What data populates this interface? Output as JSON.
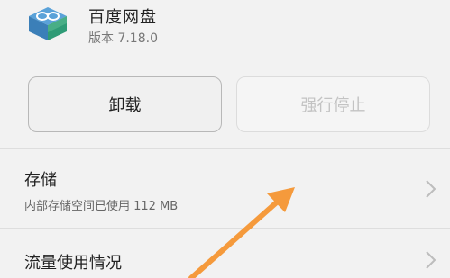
{
  "app": {
    "name": "百度网盘",
    "version": "版本 7.18.0",
    "icon": "baidu-netdisk-cube-icon"
  },
  "actions": {
    "uninstall_label": "卸载",
    "force_stop_label": "强行停止"
  },
  "rows": [
    {
      "title": "存储",
      "subtitle": "内部存储空间已使用 112 MB",
      "icon": "chevron-right-icon"
    },
    {
      "title": "流量使用情况",
      "icon": "chevron-right-icon"
    }
  ],
  "colors": {
    "background": "#f2f2f2",
    "annotation_arrow": "#f59a3c",
    "disabled_text": "#c3c3c3"
  }
}
